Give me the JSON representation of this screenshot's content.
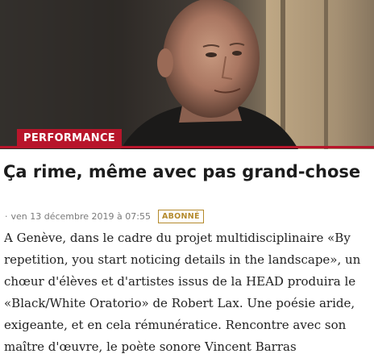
{
  "article": {
    "rubric": "PERFORMANCE",
    "title": "Ça rime, même avec pas grand-chose",
    "date": "ven 13 décembre 2019 à 07:55",
    "badge": "ABONNÉ",
    "lead": "A Genève, dans le cadre du projet multidisciplinaire «By repetition, you start noticing details in the landscape», un chœur d'élèves et d'artistes issus de la HEAD produira le «Black/White Oratorio» de Robert Lax. Une poésie aride, exigeante, et en cela rémunératice. Rencontre avec son maître d'œuvre, le poète sonore Vincent Barras"
  },
  "colors": {
    "rubric_red": "#b8152b",
    "badge_gold": "#b48a2c",
    "meta_grey": "#7a7a7a"
  }
}
